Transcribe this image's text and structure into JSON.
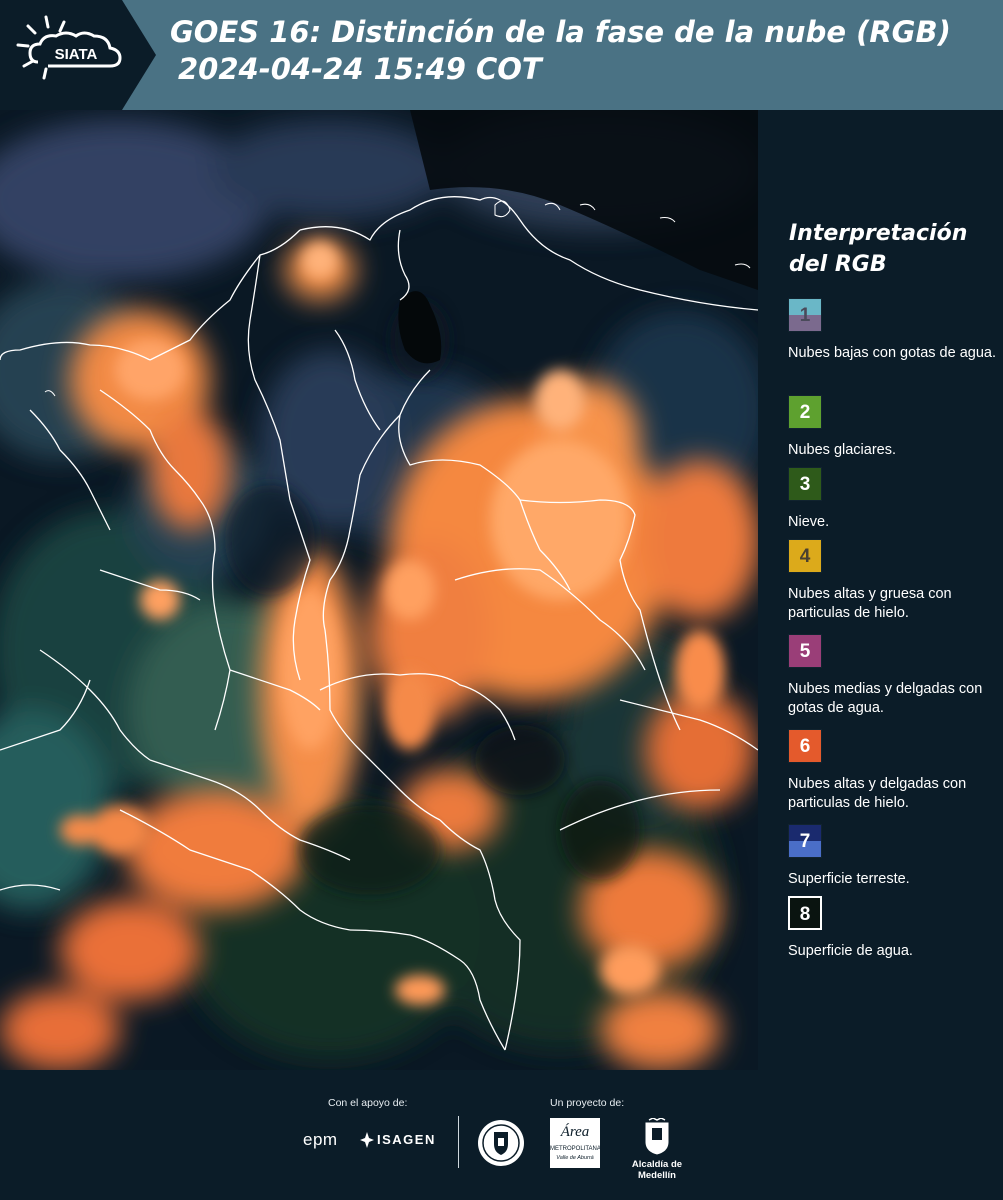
{
  "header": {
    "logo_text": "SIATA",
    "title_line_1": "GOES 16: Distinción de la fase de la nube (RGB)",
    "title_line_2": "2024-04-24 15:49 COT"
  },
  "legend": {
    "title_line_1": "Interpretación",
    "title_line_2": "del RGB",
    "items": [
      {
        "num": "1",
        "color_top": "#6ab7c7",
        "color_bottom": "#7b6a8e",
        "label": "Nubes bajas con gotas de agua.",
        "num_color": "#4a4a5a"
      },
      {
        "num": "2",
        "color_top": "#5ea12f",
        "color_bottom": "#5ea12f",
        "label": "Nubes glaciares.",
        "num_color": "#ffffff"
      },
      {
        "num": "3",
        "color_top": "#2e5a1a",
        "color_bottom": "#2e5a1a",
        "label": "Nieve.",
        "num_color": "#ffffff"
      },
      {
        "num": "4",
        "color_top": "#dcaa1b",
        "color_bottom": "#dcaa1b",
        "label": "Nubes altas y gruesa con particulas de hielo.",
        "num_color": "#4a4030"
      },
      {
        "num": "5",
        "color_top": "#9a3e78",
        "color_bottom": "#9a3e78",
        "label": "Nubes medias y delgadas con gotas de agua.",
        "num_color": "#ffffff"
      },
      {
        "num": "6",
        "color_top": "#e45a2c",
        "color_bottom": "#e45a2c",
        "label": "Nubes altas y delgadas con particulas de hielo.",
        "num_color": "#ffffff"
      },
      {
        "num": "7",
        "color_top": "#1a2a6e",
        "color_bottom": "#4a6ec8",
        "label": "Superficie terreste.",
        "num_color": "#ffffff"
      },
      {
        "num": "8",
        "color_top": "#0a1410",
        "color_bottom": "#0a1410",
        "label": "Superficie de agua.",
        "num_color": "#ffffff"
      }
    ]
  },
  "footer": {
    "support_caption": "Con el apoyo de:",
    "project_caption": "Un proyecto de:",
    "sponsor_1": "epm",
    "sponsor_2": "ISAGEN",
    "partner_area_1": "Área",
    "partner_area_2": "METROPOLITANA",
    "partner_area_3": "Valle de Aburrá",
    "partner_alcaldia": "Alcaldía de Medellín"
  },
  "colors": {
    "header_bg": "#4a7284",
    "panel_bg": "#0b1c28",
    "cloud_orange": "#f58a45",
    "border_lines": "#ffffff"
  }
}
